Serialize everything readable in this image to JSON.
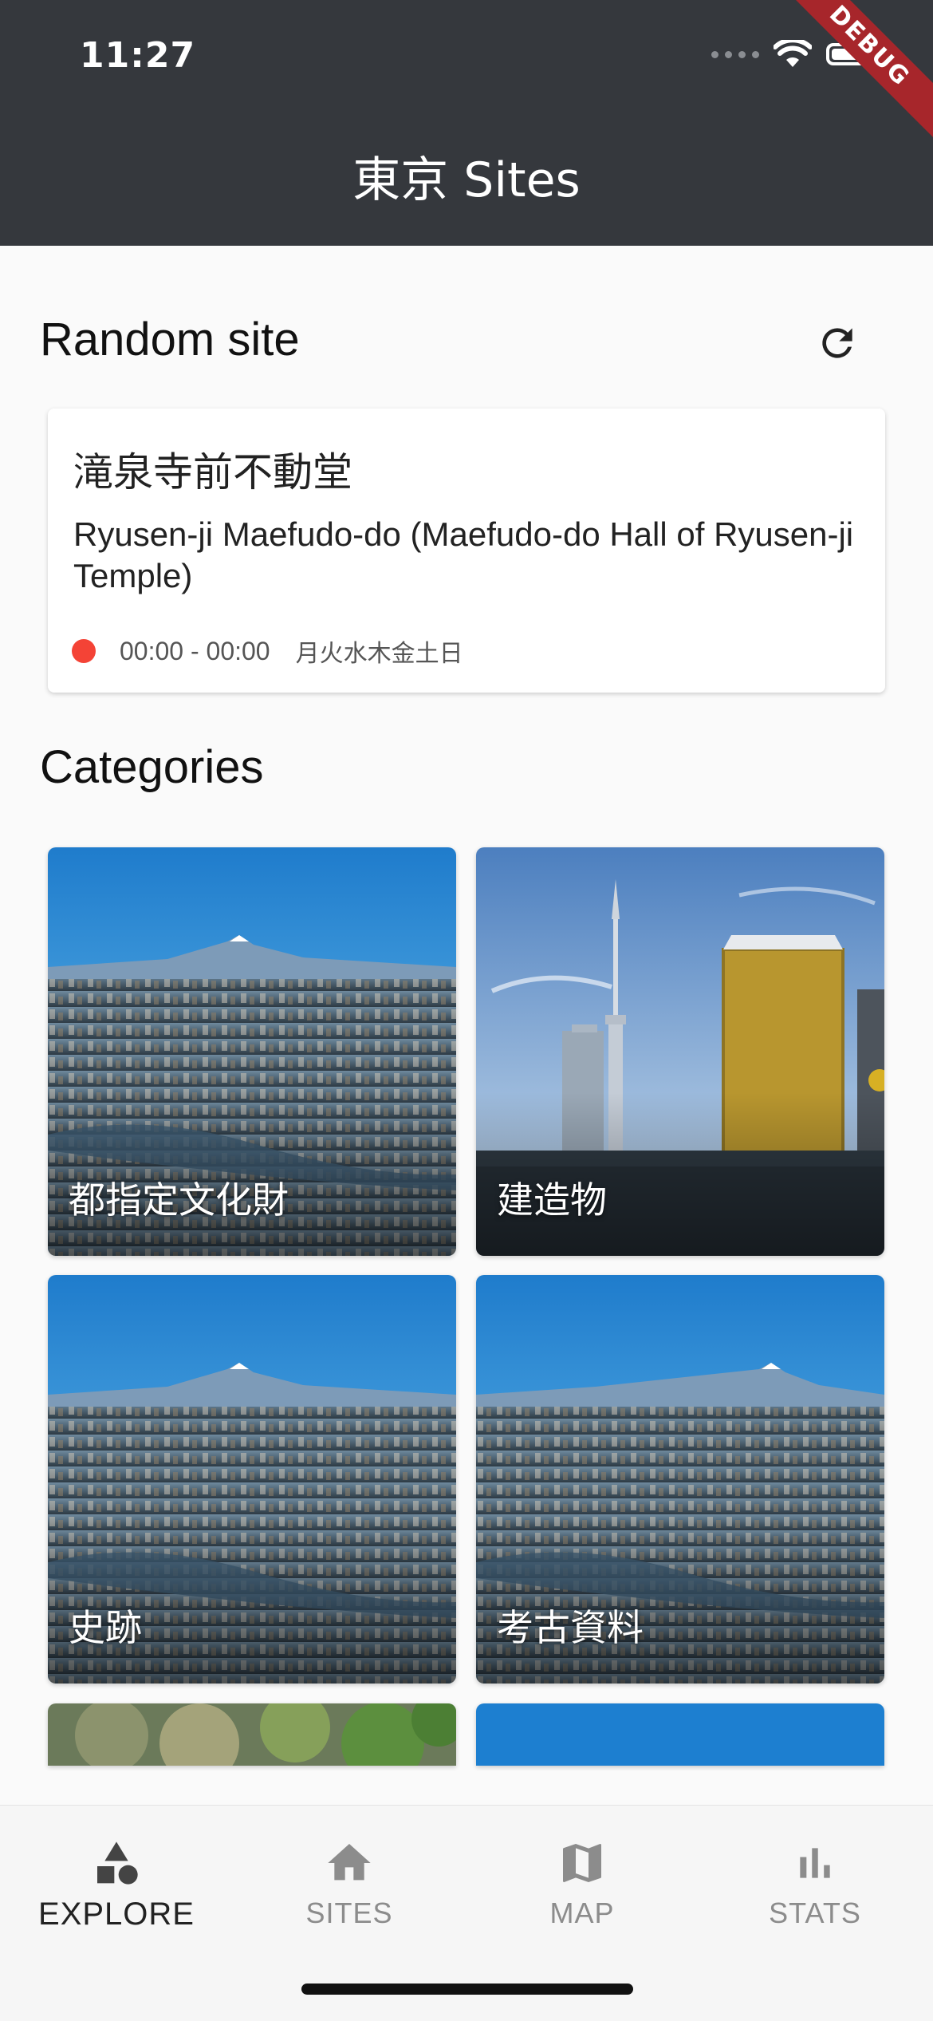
{
  "status_bar": {
    "time": "11:27",
    "debug_label": "DEBUG"
  },
  "app_bar": {
    "title": "東京 Sites"
  },
  "random_site": {
    "heading": "Random site",
    "name_ja": "滝泉寺前不動堂",
    "name_en": "Ryusen-ji Maefudo-do (Maefudo-do Hall of Ryusen-ji Temple)",
    "status_color": "#f44336",
    "hours": "00:00 - 00:00",
    "days": "月火水木金土日"
  },
  "categories": {
    "heading": "Categories",
    "items": [
      {
        "label": "都指定文化財",
        "image": "tokyo-skyline-fuji"
      },
      {
        "label": "建造物",
        "image": "skytree-asahi-buildings"
      },
      {
        "label": "史跡",
        "image": "tokyo-skyline-fuji"
      },
      {
        "label": "考古資料",
        "image": "tokyo-skyline-fuji"
      },
      {
        "label": "",
        "image": "trees"
      },
      {
        "label": "",
        "image": "sky"
      }
    ]
  },
  "bottom_nav": {
    "items": [
      {
        "label": "EXPLORE",
        "icon": "shapes-icon",
        "active": true
      },
      {
        "label": "SITES",
        "icon": "home-icon",
        "active": false
      },
      {
        "label": "MAP",
        "icon": "map-icon",
        "active": false
      },
      {
        "label": "STATS",
        "icon": "bar-chart-icon",
        "active": false
      }
    ]
  },
  "colors": {
    "app_bar": "#35383d",
    "background": "#fafafa",
    "closed_status": "#f44336"
  }
}
